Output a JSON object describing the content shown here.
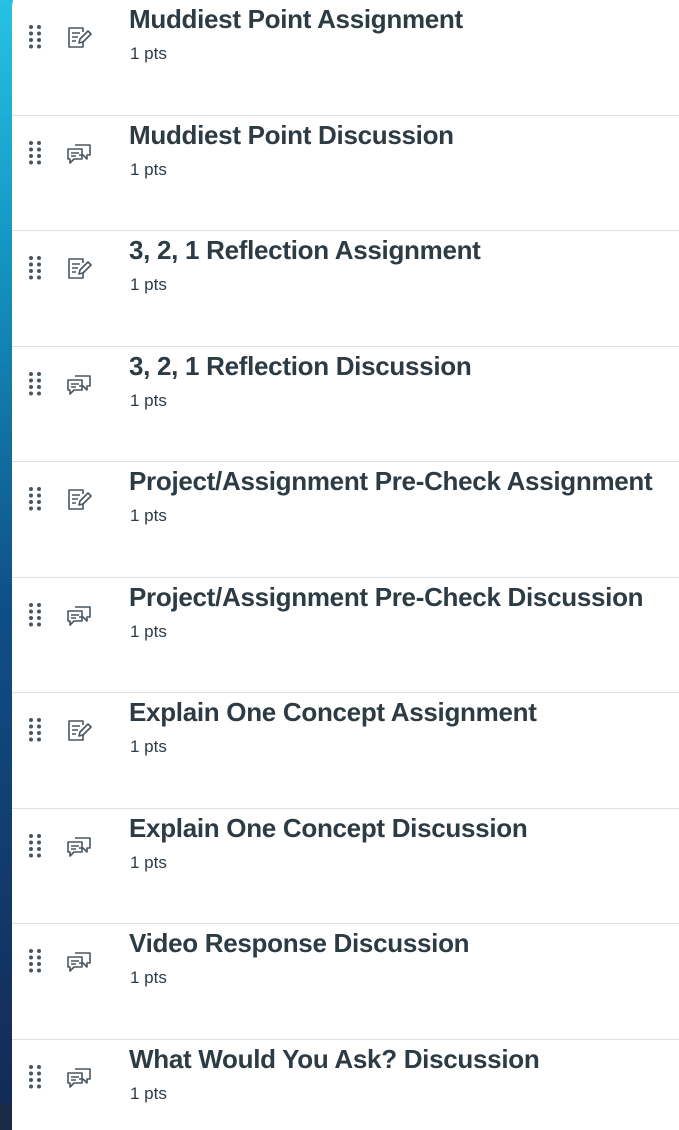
{
  "items": [
    {
      "title": "Muddiest Point Assignment",
      "points": "1 pts",
      "icon": "assignment-icon"
    },
    {
      "title": "Muddiest Point Discussion",
      "points": "1 pts",
      "icon": "discussion-icon"
    },
    {
      "title": "3, 2, 1 Reflection Assignment",
      "points": "1 pts",
      "icon": "assignment-icon"
    },
    {
      "title": "3, 2, 1 Reflection Discussion",
      "points": "1 pts",
      "icon": "discussion-icon"
    },
    {
      "title": "Project/Assignment Pre-Check Assignment",
      "points": "1 pts",
      "icon": "assignment-icon"
    },
    {
      "title": "Project/Assignment Pre-Check Discussion",
      "points": "1 pts",
      "icon": "discussion-icon"
    },
    {
      "title": "Explain One Concept Assignment",
      "points": "1 pts",
      "icon": "assignment-icon"
    },
    {
      "title": "Explain One Concept Discussion",
      "points": "1 pts",
      "icon": "discussion-icon"
    },
    {
      "title": "Video Response Discussion",
      "points": "1 pts",
      "icon": "discussion-icon"
    },
    {
      "title": "What Would You Ask? Discussion",
      "points": "1 pts",
      "icon": "discussion-icon"
    }
  ],
  "colors": {
    "text": "#2d3b45",
    "icon": "#4a5660",
    "divider": "#dcdfe3",
    "background_accent": "#1497c4"
  }
}
